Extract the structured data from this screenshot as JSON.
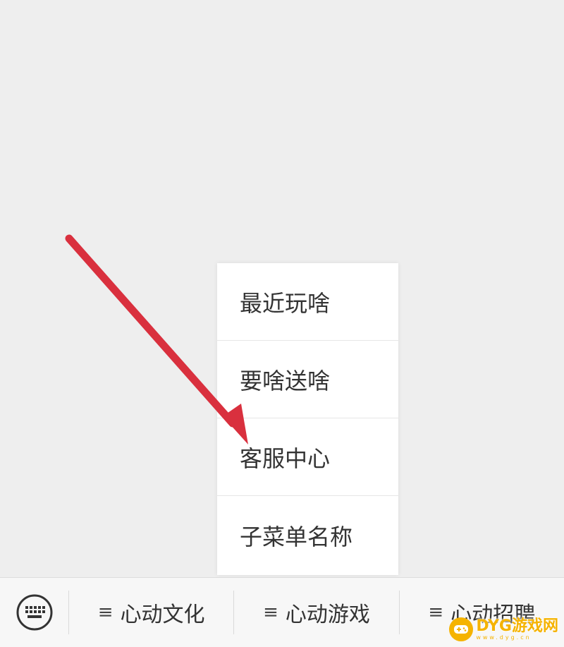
{
  "submenu": {
    "items": [
      {
        "label": "最近玩啥"
      },
      {
        "label": "要啥送啥"
      },
      {
        "label": "客服中心"
      },
      {
        "label": "子菜单名称"
      }
    ]
  },
  "bottom_bar": {
    "keyboard_icon": "keyboard-icon",
    "tabs": [
      {
        "icon": "≡",
        "label": "心动文化"
      },
      {
        "icon": "≡",
        "label": "心动游戏"
      },
      {
        "icon": "≡",
        "label": "心动招聘"
      }
    ]
  },
  "annotation": {
    "arrow_color": "#d9303e"
  },
  "watermark": {
    "text": "DYG游戏网",
    "subtext": "www.dyg.cn",
    "color": "#f5b300"
  },
  "colors": {
    "background": "#eeeeee",
    "menu_bg": "#ffffff",
    "text": "#333333"
  }
}
